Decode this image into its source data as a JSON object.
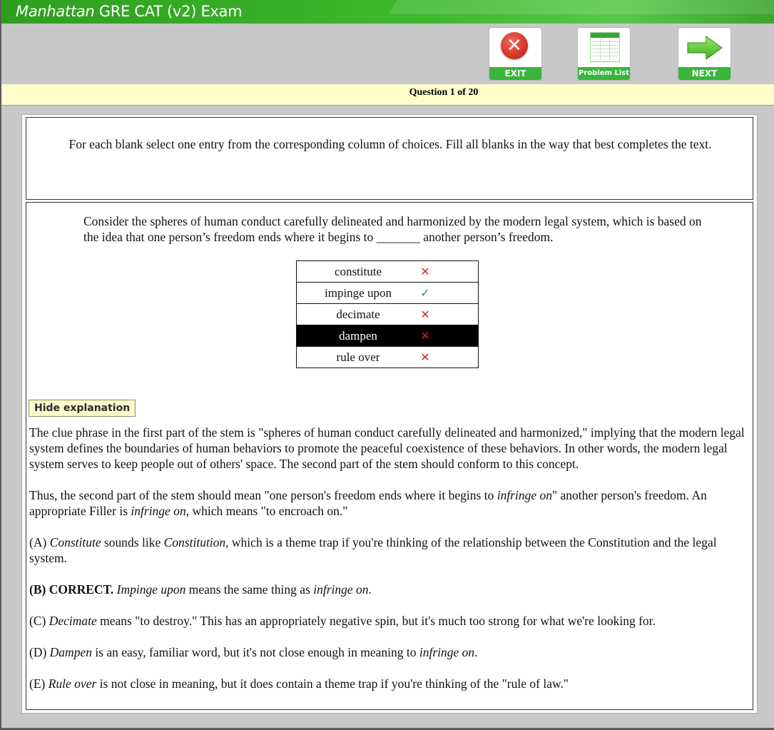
{
  "window": {
    "title_brand": "Manhattan",
    "title_rest": " GRE CAT (v2) Exam"
  },
  "toolbar": {
    "exit_label": "EXIT",
    "problem_list_label": "Problem List",
    "next_label": "NEXT",
    "exit_icon": "close-x-icon",
    "problem_list_icon": "table-grid-icon",
    "next_icon": "arrow-right-icon",
    "accent_color": "#38b53a"
  },
  "question_bar": {
    "text": "Question 1 of 20",
    "background": "#fffccb"
  },
  "instructions": {
    "text": "For each blank select one entry from the corresponding column of choices. Fill all blanks in the way that best completes the text."
  },
  "stem": {
    "before_blank": "Consider the spheres of human conduct carefully delineated and harmonized by the modern legal system, which is based on the idea that one person’s freedom ends where it begins to ",
    "blank": "_______",
    "after_blank": " another person’s freedom."
  },
  "choices": [
    {
      "text": "constitute",
      "mark": "✕",
      "status": "incorrect"
    },
    {
      "text": "impinge upon",
      "mark": "✓",
      "status": "correct"
    },
    {
      "text": "decimate",
      "mark": "✕",
      "status": "incorrect"
    },
    {
      "text": "dampen",
      "mark": "✕",
      "status": "incorrect",
      "selected": true
    },
    {
      "text": "rule over",
      "mark": "✕",
      "status": "incorrect"
    }
  ],
  "explanation": {
    "toggle_label": "Hide explanation",
    "p1": "The clue phrase in the first part of the stem is \"spheres of human conduct carefully delineated and harmonized,\" implying that the modern legal system defines the boundaries of human behaviors to promote the peaceful coexistence of these behaviors. In other words, the modern legal system serves to keep people out of others' space. The second part of the stem should conform to this concept.",
    "p2_a": "Thus, the second part of the stem should mean \"one person's freedom ends where it begins to ",
    "p2_b": "infringe on",
    "p2_c": "\" another person's freedom. An appropriate Filler is ",
    "p2_d": "infringe on,",
    "p2_e": " which means \"to encroach on.\"",
    "a_prefix": "(A) ",
    "a_word": "Constitute",
    "a_mid": " sounds like ",
    "a_word2": "Constitution,",
    "a_rest": " which is a theme trap if you're thinking of the relationship between the Constitution and the legal system.",
    "b_prefix": "(B) CORRECT.",
    "b_word": "Impinge upon",
    "b_mid": " means the same thing as ",
    "b_word2": "infringe on",
    "b_end": ".",
    "c_prefix": "(C) ",
    "c_word": "Decimate",
    "c_rest": " means \"to destroy.\" This has an appropriately negative spin, but it's much too strong for what we're looking for.",
    "d_prefix": "(D) ",
    "d_word": "Dampen",
    "d_mid": " is an easy, familiar word, but it's not close enough in meaning to ",
    "d_word2": "infringe on",
    "d_end": ".",
    "e_prefix": "(E) ",
    "e_word": "Rule over",
    "e_rest": " is not close in meaning, but it does contain a theme trap if you're thinking of the \"rule of law.\""
  }
}
